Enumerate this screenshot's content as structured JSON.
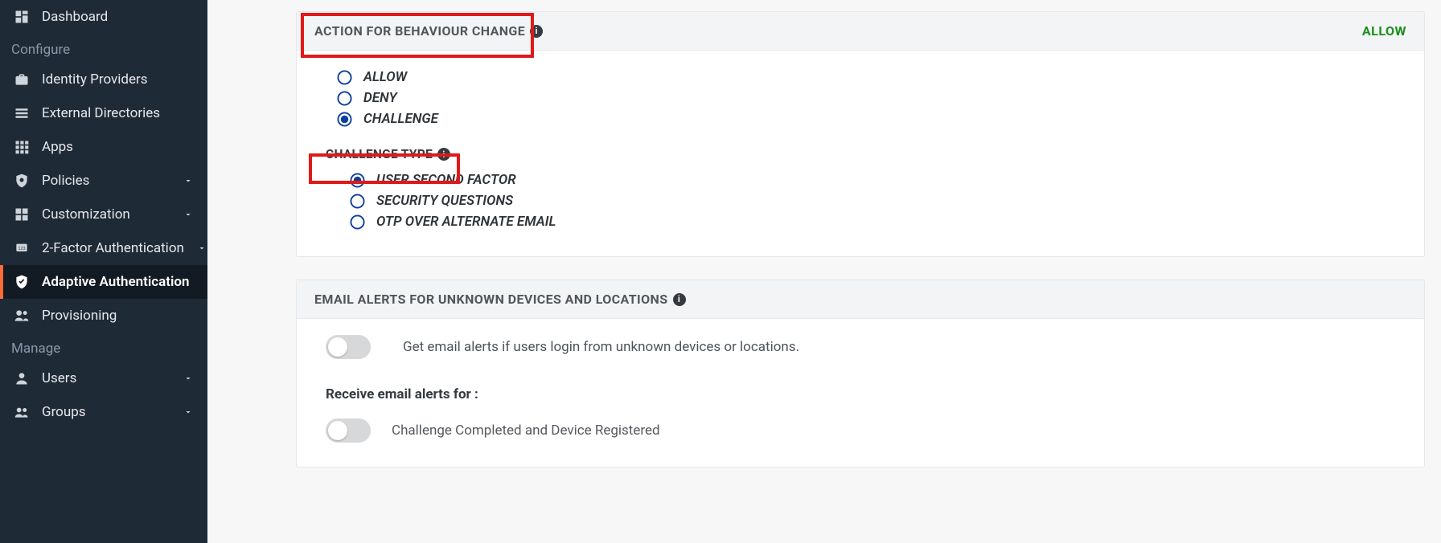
{
  "sidebar": {
    "items": [
      {
        "icon": "dashboard",
        "label": "Dashboard"
      },
      {
        "section": "Configure"
      },
      {
        "icon": "idp",
        "label": "Identity Providers"
      },
      {
        "icon": "extdir",
        "label": "External Directories"
      },
      {
        "icon": "apps",
        "label": "Apps"
      },
      {
        "icon": "policies",
        "label": "Policies",
        "chevron": true
      },
      {
        "icon": "custom",
        "label": "Customization",
        "chevron": true
      },
      {
        "icon": "twofa",
        "label": "2-Factor Authentication",
        "chevron": true
      },
      {
        "icon": "adaptive",
        "label": "Adaptive Authentication",
        "active": true
      },
      {
        "icon": "prov",
        "label": "Provisioning"
      },
      {
        "section": "Manage"
      },
      {
        "icon": "users",
        "label": "Users",
        "chevron": true
      },
      {
        "icon": "groups",
        "label": "Groups",
        "chevron": true
      }
    ]
  },
  "panel1": {
    "title": "ACTION FOR BEHAVIOUR CHANGE",
    "badge": "ALLOW",
    "actions": [
      {
        "label": "ALLOW",
        "selected": false
      },
      {
        "label": "DENY",
        "selected": false
      },
      {
        "label": "CHALLENGE",
        "selected": true
      }
    ],
    "challenge_heading": "CHALLENGE TYPE",
    "challenge_types": [
      {
        "label": "USER SECOND FACTOR",
        "selected": true
      },
      {
        "label": "SECURITY QUESTIONS",
        "selected": false
      },
      {
        "label": "OTP OVER ALTERNATE EMAIL",
        "selected": false
      }
    ]
  },
  "panel2": {
    "title": "EMAIL ALERTS FOR UNKNOWN DEVICES AND LOCATIONS",
    "toggle_desc": "Get email alerts if users login from unknown devices or locations.",
    "subheading": "Receive email alerts for :",
    "row2_text": "Challenge Completed and Device Registered"
  }
}
